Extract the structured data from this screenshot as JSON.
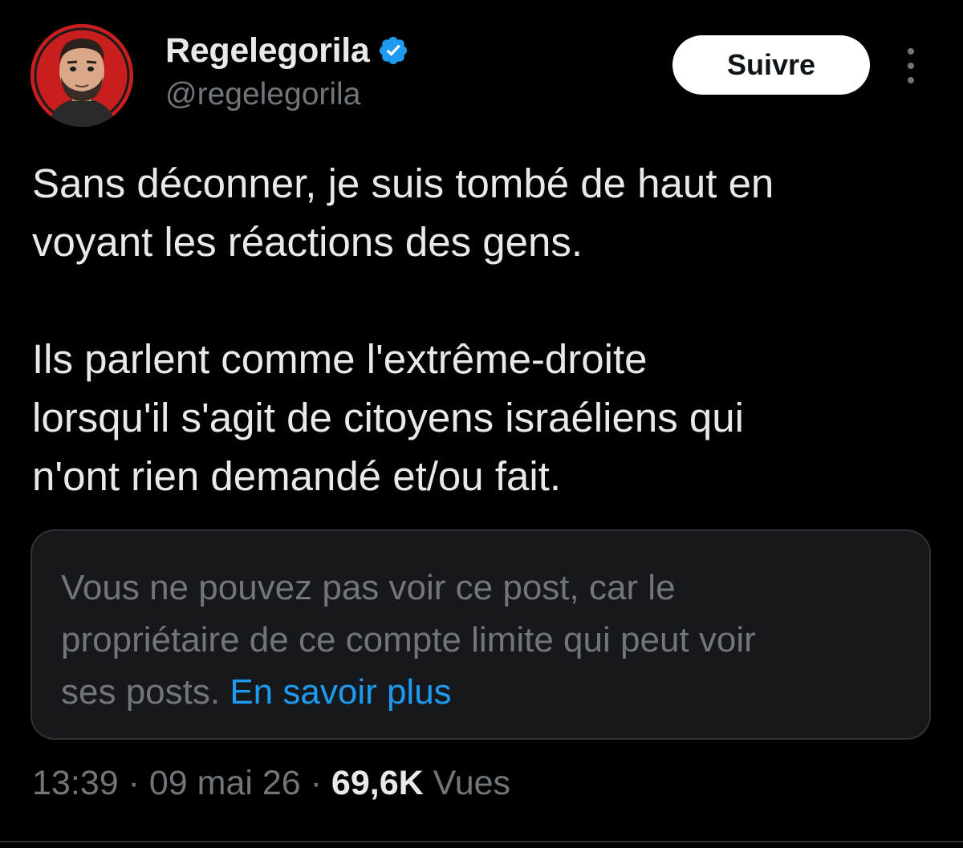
{
  "author": {
    "display_name": "Regelegorila",
    "handle": "@regelegorila",
    "verified": true,
    "avatar_background": "#c81e1e"
  },
  "actions": {
    "follow_label": "Suivre"
  },
  "tweet": {
    "line_1": "Sans déconner, je suis tombé de haut en",
    "line_2": "voyant les réactions des gens.",
    "line_3": "Ils parlent comme l'extrême-droite",
    "line_4": "lorsqu'il s'agit de citoyens israéliens qui",
    "line_5": "n'ont rien demandé et/ou fait."
  },
  "quote_notice": {
    "line_1": "Vous ne pouvez pas voir ce post, car le",
    "line_2": "propriétaire de ce compte limite qui peut voir",
    "line_3_prefix": "ses posts.",
    "link": "En savoir plus"
  },
  "meta": {
    "time": "13:39",
    "date": "09 mai 26",
    "separator": "·",
    "views_count": "69,6K",
    "views_label": "Vues"
  },
  "colors": {
    "background": "#000000",
    "text_primary": "#e7e9ea",
    "text_secondary": "#71767b",
    "link": "#1d9bf0",
    "verified_badge": "#1d9bf0",
    "card_background": "#16181c",
    "border": "#2f3336"
  }
}
